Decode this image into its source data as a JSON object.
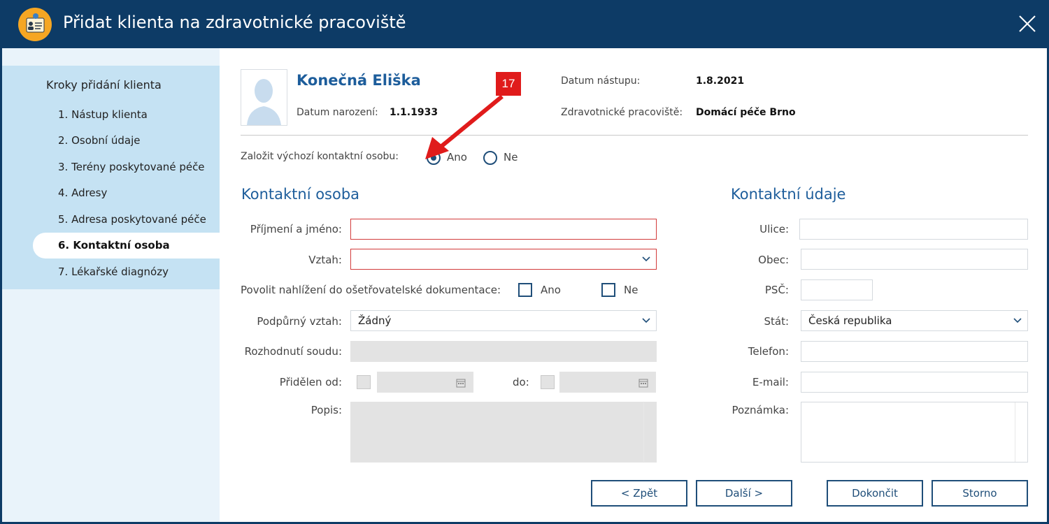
{
  "window": {
    "title": "Přidat klienta na zdravotnické pracoviště"
  },
  "sidebar": {
    "title": "Kroky přidání klienta",
    "steps": [
      "1. Nástup klienta",
      "2. Osobní údaje",
      "3. Terény poskytované péče",
      "4. Adresy",
      "5. Adresa poskytované péče",
      "6. Kontaktní osoba",
      "7. Lékařské diagnózy"
    ],
    "active_step_index": 5
  },
  "client": {
    "name": "Konečná Eliška",
    "birth_label": "Datum narození:",
    "birth_value": "1.1.1933",
    "start_label": "Datum nástupu:",
    "start_value": "1.8.2021",
    "workplace_label": "Zdravotnické pracoviště:",
    "workplace_value": "Domácí péče Brno"
  },
  "default_contact": {
    "label": "Založit výchozí kontaktní osobu:",
    "yes": "Ano",
    "no": "Ne",
    "selected": "Ano"
  },
  "contact_person": {
    "title": "Kontaktní osoba",
    "name_label": "Příjmení a jméno:",
    "name_value": "",
    "relation_label": "Vztah:",
    "relation_value": "",
    "access_label": "Povolit nahlížení do ošetřovatelské dokumentace:",
    "access_yes": "Ano",
    "access_no": "Ne",
    "support_label": "Podpůrný vztah:",
    "support_value": "Žádný",
    "court_label": "Rozhodnutí soudu:",
    "assigned_from_label": "Přidělen od:",
    "assigned_to_label": "do:",
    "description_label": "Popis:"
  },
  "contact_details": {
    "title": "Kontaktní údaje",
    "street_label": "Ulice:",
    "city_label": "Obec:",
    "zip_label": "PSČ:",
    "country_label": "Stát:",
    "country_value": "Česká republika",
    "phone_label": "Telefon:",
    "email_label": "E-mail:",
    "note_label": "Poznámka:"
  },
  "buttons": {
    "back": "< Zpět",
    "next": "Další >",
    "finish": "Dokončit",
    "cancel": "Storno"
  },
  "annotation": {
    "badge": "17"
  },
  "colors": {
    "titlebar": "#0d3b66",
    "accent": "#1d5d9b",
    "required_border": "#d23b3b",
    "badge": "#e01b1b"
  }
}
